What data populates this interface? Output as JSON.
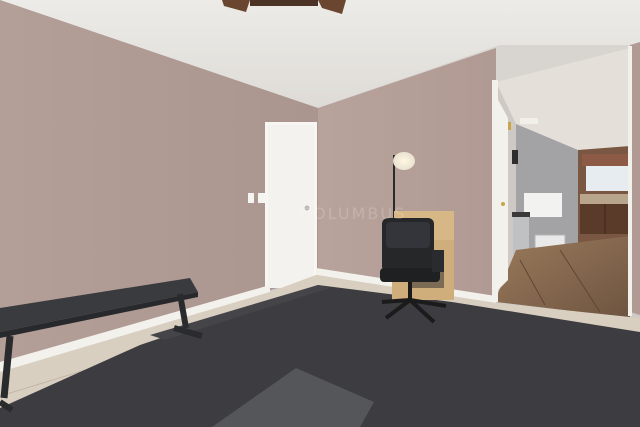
{
  "scene": {
    "kind": "interior photo",
    "watermark_text": "COLUMBUS",
    "palette": {
      "wall": "#b39e98",
      "wall_shadow": "#a48f89",
      "ceiling": "#e9e6e1",
      "floor_mat": "#3d3d41",
      "tile": "#d9cfc1",
      "baseboard": "#f3f1ec",
      "door": "#f4f3ef",
      "hall_floor": "#8a6c50",
      "kitchen_cabinet": "#5a3a28"
    }
  }
}
